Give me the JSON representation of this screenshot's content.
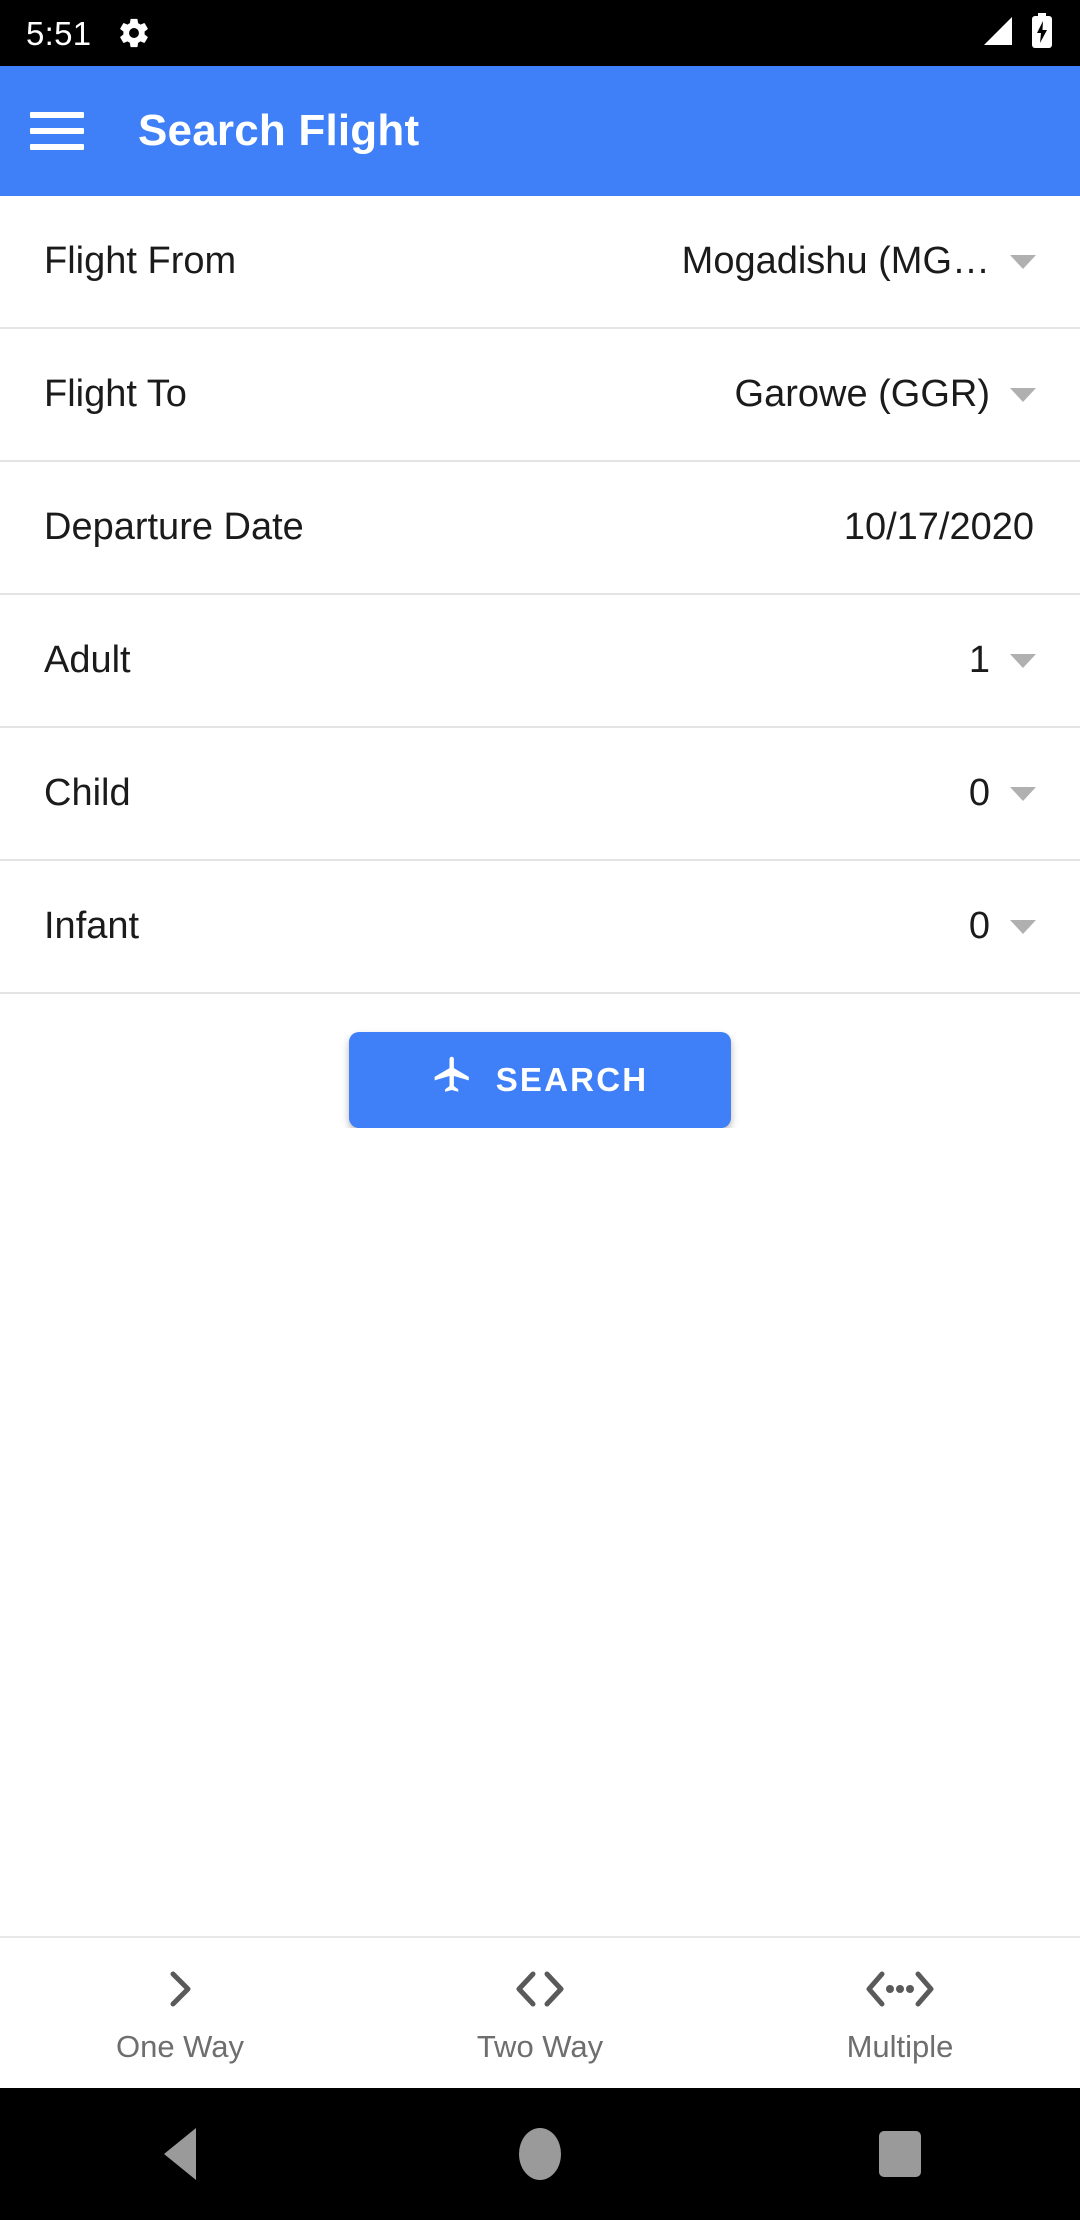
{
  "status_bar": {
    "time": "5:51",
    "gear_icon": "settings-gear-icon",
    "signal_icon": "cellular-signal-icon",
    "battery_icon": "battery-charging-icon"
  },
  "app_bar": {
    "menu_icon": "hamburger-menu-icon",
    "title": "Search Flight",
    "background_color": "#3F80F8"
  },
  "form": {
    "rows": [
      {
        "label": "Flight From",
        "value": "Mogadishu (MG…",
        "has_caret": true
      },
      {
        "label": "Flight To",
        "value": "Garowe (GGR)",
        "has_caret": true
      },
      {
        "label": "Departure Date",
        "value": "10/17/2020",
        "has_caret": false
      },
      {
        "label": "Adult",
        "value": "1",
        "has_caret": true
      },
      {
        "label": "Child",
        "value": "0",
        "has_caret": true
      },
      {
        "label": "Infant",
        "value": "0",
        "has_caret": true
      }
    ]
  },
  "search_button": {
    "label": "SEARCH",
    "icon": "airplane-icon",
    "background_color": "#3F80F8"
  },
  "bottom_tabs": {
    "items": [
      {
        "label": "One Way",
        "icon": "chevron-right-icon"
      },
      {
        "label": "Two Way",
        "icon": "chevron-left-right-icon"
      },
      {
        "label": "Multiple",
        "icon": "chevron-dots-icon"
      }
    ]
  },
  "android_nav": {
    "back": "back-triangle-icon",
    "home": "home-circle-icon",
    "recents": "recents-square-icon"
  }
}
